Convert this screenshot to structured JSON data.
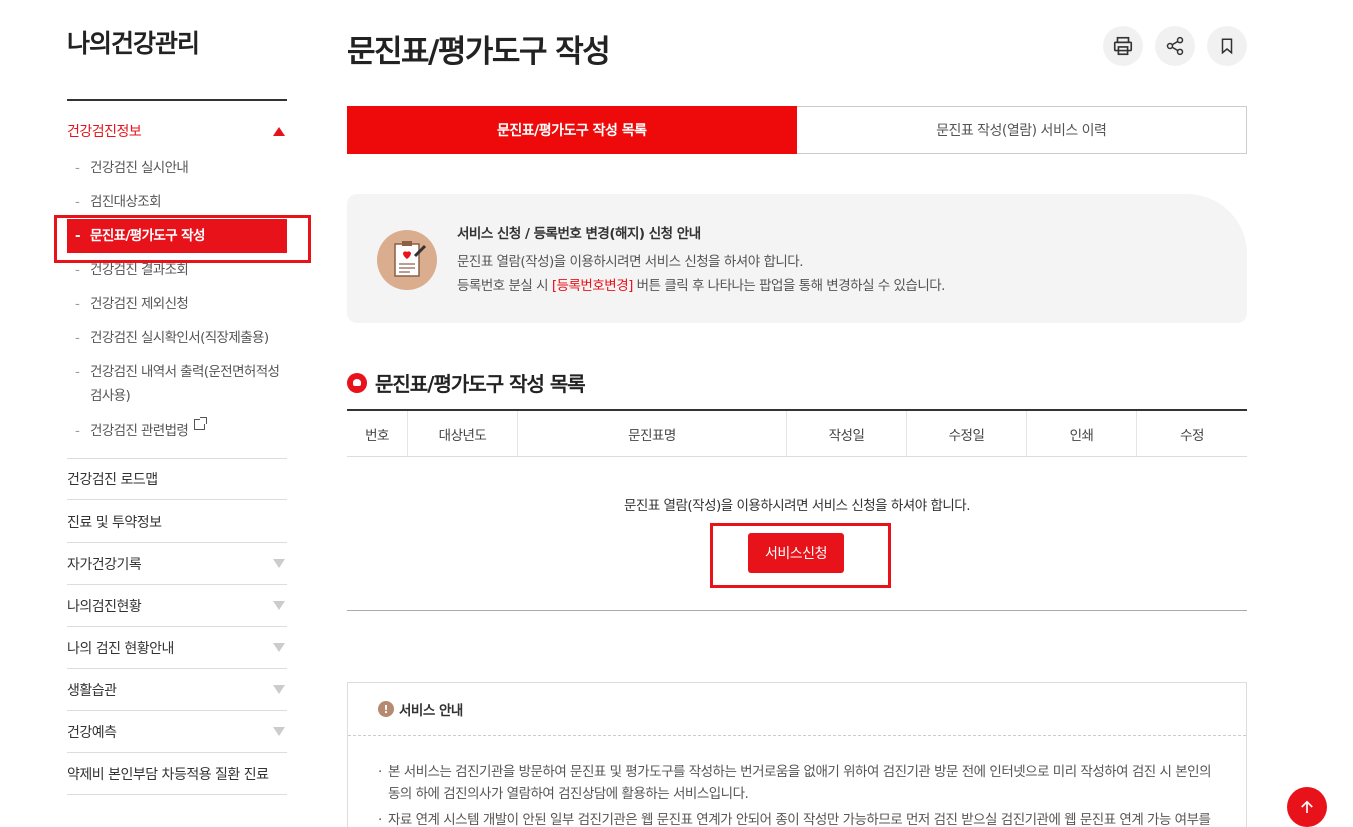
{
  "sidebar": {
    "title": "나의건강관리",
    "section_label": "건강검진정보",
    "sub_items": [
      "건강검진 실시안내",
      "검진대상조회",
      "문진표/평가도구 작성",
      "건강검진 결과조회",
      "건강검진 제외신청",
      "건강검진 실시확인서(직장제출용)",
      "건강검진 내역서 출력(운전면허적성검사용)",
      "건강검진 관련법령"
    ],
    "menu_items": [
      "건강검진 로드맵",
      "진료 및 투약정보",
      "자가건강기록",
      "나의검진현황",
      "나의 검진 현황안내",
      "생활습관",
      "건강예측",
      "약제비 본인부담 차등적용 질환 진료"
    ],
    "dash": "-"
  },
  "page": {
    "title": "문진표/평가도구 작성",
    "icons": [
      "print-icon",
      "share-icon",
      "bookmark-icon"
    ]
  },
  "tabs": {
    "active": "문진표/평가도구 작성 목록",
    "inactive": "문진표 작성(열람) 서비스 이력"
  },
  "notice": {
    "title": "서비스 신청 / 등록번호 변경(해지) 신청 안내",
    "line1": "문진표 열람(작성)을 이용하시려면 서비스 신청을 하셔야 합니다.",
    "line2_pre": "등록번호 분실 시 ",
    "line2_link": "[등록번호변경]",
    "line2_post": " 버튼 클릭 후 나타나는 팝업을 통해 변경하실 수 있습니다."
  },
  "list": {
    "title": "문진표/평가도구 작성 목록",
    "columns": [
      "번호",
      "대상년도",
      "문진표명",
      "작성일",
      "수정일",
      "인쇄",
      "수정"
    ],
    "empty_message": "문진표 열람(작성)을 이용하시려면 서비스 신청을 하셔야 합니다.",
    "apply_button": "서비스신청"
  },
  "service_info": {
    "title": "서비스 안내",
    "excl": "!",
    "para1": "본 서비스는 검진기관을 방문하여 문진표 및 평가도구를 작성하는 번거로움을 없애기 위하여 검진기관 방문 전에 인터넷으로 미리 작성하여 검진 시 본인의 동의 하에 검진의사가 열람하여 검진상담에 활용하는 서비스입니다.",
    "para2": "자료 연계 시스템 개발이 안된 일부 검진기관은 웹 문진표 연계가 안되어 종이 작성만 가능하므로 먼저 검진 받으실 검진기관에 웹 문진표 연계 가능 여부를 확인하시기 바랍니다."
  },
  "colors": {
    "accent": "#e8121a",
    "tab_active": "#ee0a0a",
    "notice_bg": "#f4f4f4",
    "notice_icon": "#d9ad8e"
  }
}
